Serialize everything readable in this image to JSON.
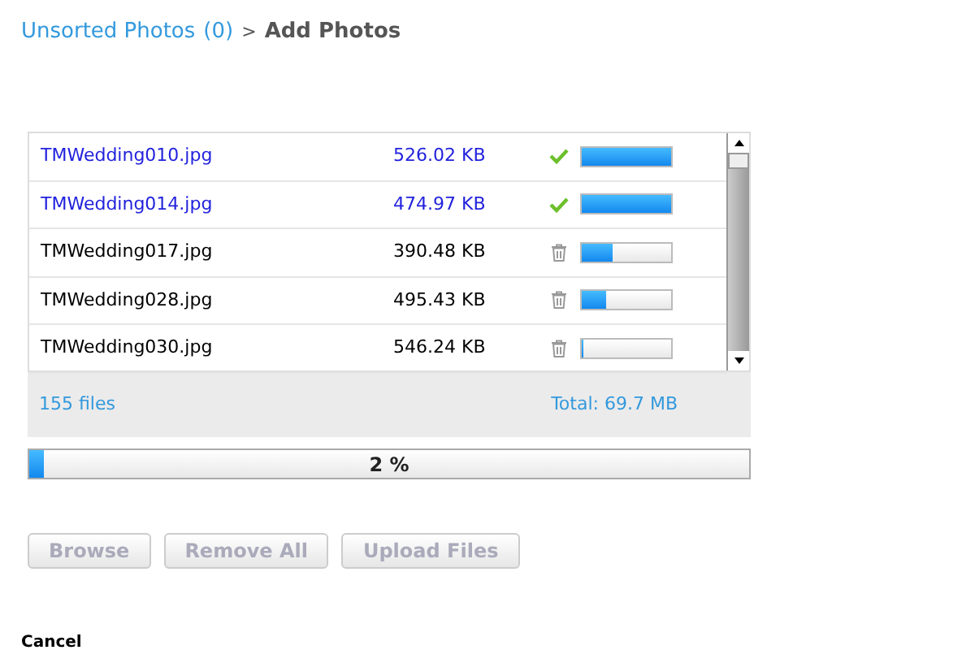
{
  "breadcrumb": {
    "link": "Unsorted Photos",
    "count": "(0)",
    "separator": ">",
    "current": "Add Photos"
  },
  "files": [
    {
      "name": "TMWedding010.jpg",
      "size": "526.02 KB",
      "kind": "done",
      "level": 1
    },
    {
      "name": "TMWedding014.jpg",
      "size": "474.97 KB",
      "kind": "done",
      "level": 1
    },
    {
      "name": "TMWedding017.jpg",
      "size": "390.48 KB",
      "kind": "pending",
      "level": 0.35
    },
    {
      "name": "TMWedding028.jpg",
      "size": "495.43 KB",
      "kind": "pending",
      "level": 0.27
    },
    {
      "name": "TMWedding030.jpg",
      "size": "546.24 KB",
      "kind": "pending",
      "level": 0
    }
  ],
  "summary": {
    "count": "155 files",
    "total": "Total: 69.7 MB"
  },
  "overall": {
    "level": 0.02,
    "reading": "2 %"
  },
  "buttons": [
    {
      "label": "Browse",
      "disabled": true
    },
    {
      "label": "Remove All",
      "disabled": true
    },
    {
      "label": "Upload Files",
      "disabled": true
    }
  ],
  "cancel": "Cancel"
}
